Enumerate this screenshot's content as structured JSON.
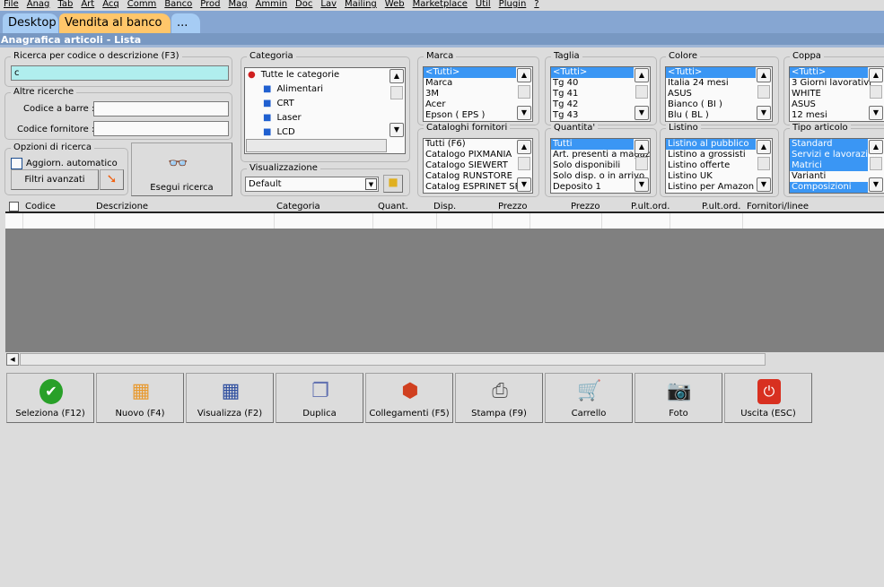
{
  "menu": [
    "File",
    "Anag",
    "Tab",
    "Art",
    "Acq",
    "Comm",
    "Banco",
    "Prod",
    "Mag",
    "Ammin",
    "Doc",
    "Lav",
    "Mailing",
    "Web",
    "Marketplace",
    "Util",
    "Plugin",
    "?"
  ],
  "tabs": [
    "Desktop",
    "Vendita al banco",
    "..."
  ],
  "window_title": "Anagrafica articoli  - Lista",
  "search": {
    "label": "Ricerca per codice o descrizione (F3)",
    "value": "c"
  },
  "other": {
    "label": "Altre ricerche",
    "barcode_label": "Codice a barre :",
    "supplier_label": "Codice fornitore :"
  },
  "options": {
    "label": "Opzioni di ricerca",
    "auto_update": "Aggiorn. automatico",
    "advanced": "Filtri avanzati",
    "execute": "Esegui ricerca"
  },
  "category": {
    "label": "Categoria",
    "items": [
      "Tutte le categorie",
      "Alimentari",
      "CRT",
      "Laser",
      "LCD"
    ]
  },
  "view": {
    "label": "Visualizzazione",
    "value": "Default"
  },
  "lists": [
    {
      "label": "Marca",
      "items": [
        "<Tutti>",
        "Marca",
        "3M",
        "Acer",
        "Epson ( EPS )"
      ],
      "selected": [
        0
      ]
    },
    {
      "label": "Taglia",
      "items": [
        "<Tutti>",
        "Tg 40",
        "Tg 41",
        "Tg 42",
        "Tg 43"
      ],
      "selected": [
        0
      ]
    },
    {
      "label": "Colore",
      "items": [
        "<Tutti>",
        "Italia 24 mesi",
        "ASUS",
        "Bianco ( BI )",
        "Blu ( BL )"
      ],
      "selected": [
        0
      ]
    },
    {
      "label": "Coppa",
      "items": [
        "<Tutti>",
        "3 Giorni lavorativi",
        "WHITE",
        "ASUS",
        "12 mesi"
      ],
      "selected": [
        0
      ]
    },
    {
      "label": "Cataloghi fornitori",
      "items": [
        "Tutti (F6)",
        "Catalogo PIXMANIA",
        "Catalogo SIEWERT",
        "Catalog RUNSTORE",
        "Catalog ESPRINET SPA"
      ],
      "selected": []
    },
    {
      "label": "Quantita'",
      "items": [
        "Tutti",
        "Art. presenti a magazzino",
        "Solo disponibili",
        "Solo disp. o in arrivo",
        "Deposito 1"
      ],
      "selected": [
        0
      ]
    },
    {
      "label": "Listino",
      "items": [
        "Listino al pubblico",
        "Listino a grossisti",
        "Listino offerte",
        "Listino UK",
        "Listino per Amazon"
      ],
      "selected": [
        0
      ]
    },
    {
      "label": "Tipo articolo",
      "items": [
        "Standard",
        "Servizi e lavorazioni",
        "Matrici",
        "Varianti",
        "Composizioni"
      ],
      "selected": [
        0,
        1,
        2,
        4
      ]
    }
  ],
  "columns": [
    "Codice",
    "Descrizione",
    "Categoria",
    "Quant.",
    "Disp.",
    "Prezzo",
    "Prezzo",
    "P.ult.ord.",
    "P.ult.ord.",
    "Fornitori/linee"
  ],
  "toolbar": [
    {
      "label": "Seleziona (F12)",
      "icon": "check-icon"
    },
    {
      "label": "Nuovo (F4)",
      "icon": "new-grid-icon"
    },
    {
      "label": "Visualizza (F2)",
      "icon": "view-grid-icon"
    },
    {
      "label": "Duplica",
      "icon": "duplicate-icon"
    },
    {
      "label": "Collegamenti (F5)",
      "icon": "links-icon"
    },
    {
      "label": "Stampa (F9)",
      "icon": "printer-icon"
    },
    {
      "label": "Carrello",
      "icon": "cart-icon"
    },
    {
      "label": "Foto",
      "icon": "camera-icon"
    },
    {
      "label": "Uscita (ESC)",
      "icon": "exit-icon"
    }
  ]
}
